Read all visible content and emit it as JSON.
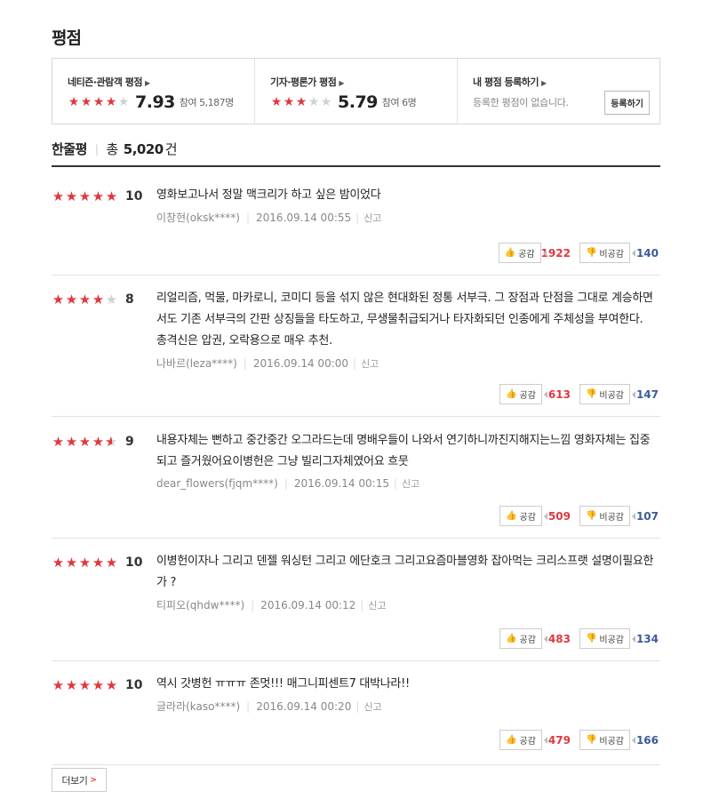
{
  "section_title": "평점",
  "summary": {
    "netizen": {
      "label": "네티즌·관람객 평점",
      "stars": 4,
      "score": "7.93",
      "participants": "참여 5,187명"
    },
    "critic": {
      "label": "기자·평론가 평점",
      "stars": 3,
      "score": "5.79",
      "participants": "참여 6명"
    },
    "mine": {
      "label": "내 평점 등록하기",
      "desc": "등록한 평점이 없습니다.",
      "button": "등록하기"
    }
  },
  "list_header": {
    "label": "한줄평",
    "total_prefix": "총",
    "total": "5,020",
    "total_suffix": "건"
  },
  "icons": {
    "star": "star-icon",
    "like": "thumbs-up-icon",
    "dislike": "thumbs-down-icon",
    "arrow": "chevron-right-icon"
  },
  "colors": {
    "accent": "#e0383e",
    "dislike_count": "#3a5a9a"
  },
  "reviews": [
    {
      "score": "10",
      "stars": 5,
      "text": "영화보고나서 정말 맥크리가 하고 싶은 밤이었다",
      "user": "이창현(oksk****)",
      "date": "2016.09.14 00:55",
      "report": "신고",
      "like_label": "공감",
      "likes": "1922",
      "dislike_label": "비공감",
      "dislikes": "140"
    },
    {
      "score": "8",
      "stars": 4,
      "text": "리얼리즘, 먹물, 마카로니, 코미디 등을 섞지 않은 현대화된 정통 서부극. 그 장점과 단점을 그대로 계승하면서도 기존 서부극의 간판 상징들을 타도하고, 무생물취급되거나 타자화되던 인종에게 주체성을 부여한다. 총격신은 압권, 오락용으로 매우 추천.",
      "user": "나바르(leza****)",
      "date": "2016.09.14 00:00",
      "report": "신고",
      "like_label": "공감",
      "likes": "613",
      "dislike_label": "비공감",
      "dislikes": "147"
    },
    {
      "score": "9",
      "stars": 4.5,
      "text": "내용자체는 뻔하고 중간중간 오그라드는데 명배우들이 나와서 연기하니까진지해지는느낌 영화자체는 집중되고 즐거웠어요이병헌은 그냥 빌리그자체였어요 흐뭇",
      "user": "dear_flowers(fjqm****)",
      "date": "2016.09.14 00:15",
      "report": "신고",
      "like_label": "공감",
      "likes": "509",
      "dislike_label": "비공감",
      "dislikes": "107"
    },
    {
      "score": "10",
      "stars": 5,
      "text": "이병헌이자나 그리고 덴젤 워싱턴 그리고 에단호크 그리고요즘마블영화 잡아먹는 크리스프랫 설명이필요한가 ?",
      "user": "티피오(qhdw****)",
      "date": "2016.09.14 00:12",
      "report": "신고",
      "like_label": "공감",
      "likes": "483",
      "dislike_label": "비공감",
      "dislikes": "134"
    },
    {
      "score": "10",
      "stars": 5,
      "text": "역시 갓병헌 ㅠㅠㅠ 존멋!!! 매그니피센트7 대박나라!!",
      "user": "글라라(kaso****)",
      "date": "2016.09.14 00:20",
      "report": "신고",
      "like_label": "공감",
      "likes": "479",
      "dislike_label": "비공감",
      "dislikes": "166"
    }
  ],
  "more_button": "더보기"
}
